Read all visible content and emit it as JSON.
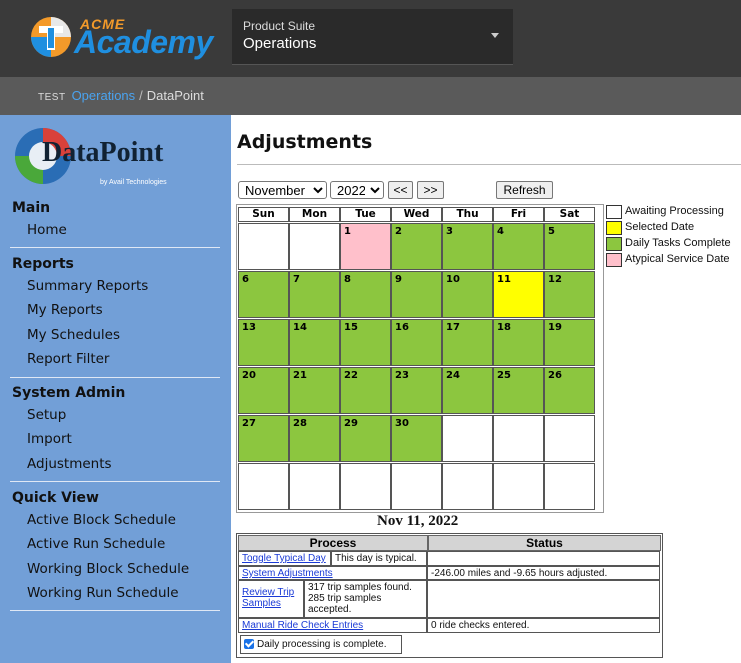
{
  "app": {
    "brand_top": "ACME",
    "brand_main": "Academy",
    "suite_label": "Product Suite",
    "suite_value": "Operations"
  },
  "breadcrumb": {
    "env": "TEST",
    "parent": "Operations",
    "separator": "/",
    "current": "DataPoint"
  },
  "sidebar": {
    "logo_text": "DataPoint",
    "logo_sub": "by Avail Technologies",
    "sections": [
      {
        "title": "Main",
        "items": [
          "Home"
        ]
      },
      {
        "title": "Reports",
        "items": [
          "Summary Reports",
          "My Reports",
          "My Schedules",
          "Report Filter"
        ]
      },
      {
        "title": "System Admin",
        "items": [
          "Setup",
          "Import",
          "Adjustments"
        ]
      },
      {
        "title": "Quick View",
        "items": [
          "Active Block Schedule",
          "Active Run Schedule",
          "Working Block Schedule",
          "Working Run Schedule"
        ]
      }
    ]
  },
  "page": {
    "title": "Adjustments"
  },
  "controls": {
    "month": "November",
    "year": "2022",
    "prev": "<<",
    "next": ">>",
    "refresh": "Refresh"
  },
  "calendar": {
    "days_of_week": [
      "Sun",
      "Mon",
      "Tue",
      "Wed",
      "Thu",
      "Fri",
      "Sat"
    ],
    "weeks": [
      [
        null,
        null,
        {
          "d": "1",
          "s": "atypical"
        },
        {
          "d": "2",
          "s": "complete"
        },
        {
          "d": "3",
          "s": "complete"
        },
        {
          "d": "4",
          "s": "complete"
        },
        {
          "d": "5",
          "s": "complete"
        }
      ],
      [
        {
          "d": "6",
          "s": "complete"
        },
        {
          "d": "7",
          "s": "complete"
        },
        {
          "d": "8",
          "s": "complete"
        },
        {
          "d": "9",
          "s": "complete"
        },
        {
          "d": "10",
          "s": "complete"
        },
        {
          "d": "11",
          "s": "selected"
        },
        {
          "d": "12",
          "s": "complete"
        }
      ],
      [
        {
          "d": "13",
          "s": "complete"
        },
        {
          "d": "14",
          "s": "complete"
        },
        {
          "d": "15",
          "s": "complete"
        },
        {
          "d": "16",
          "s": "complete"
        },
        {
          "d": "17",
          "s": "complete"
        },
        {
          "d": "18",
          "s": "complete"
        },
        {
          "d": "19",
          "s": "complete"
        }
      ],
      [
        {
          "d": "20",
          "s": "complete"
        },
        {
          "d": "21",
          "s": "complete"
        },
        {
          "d": "22",
          "s": "complete"
        },
        {
          "d": "23",
          "s": "complete"
        },
        {
          "d": "24",
          "s": "complete"
        },
        {
          "d": "25",
          "s": "complete"
        },
        {
          "d": "26",
          "s": "complete"
        }
      ],
      [
        {
          "d": "27",
          "s": "complete"
        },
        {
          "d": "28",
          "s": "complete"
        },
        {
          "d": "29",
          "s": "complete"
        },
        {
          "d": "30",
          "s": "complete"
        },
        null,
        null,
        null
      ],
      [
        null,
        null,
        null,
        null,
        null,
        null,
        null
      ]
    ]
  },
  "legend": [
    {
      "label": "Awaiting Processing",
      "color": "#ffffff"
    },
    {
      "label": "Selected Date",
      "color": "#ffff00"
    },
    {
      "label": "Daily Tasks Complete",
      "color": "#8cc63f"
    },
    {
      "label": "Atypical Service Date",
      "color": "#ffc0cb"
    }
  ],
  "status_colors": {
    "complete": "#8cc63f",
    "selected": "#ffff00",
    "atypical": "#ffc0cb",
    "awaiting": "#ffffff"
  },
  "selected_date": "Nov 11, 2022",
  "process_table": {
    "headers": [
      "Process",
      "Status"
    ],
    "rows": {
      "toggle_link": "Toggle Typical Day",
      "toggle_note": "This day is typical.",
      "sys_adj_link": "System Adjustments",
      "sys_adj_status": "-246.00 miles and -9.65 hours adjusted.",
      "review_link": "Review Trip Samples",
      "review_note": "317 trip samples found. 285 trip samples accepted.",
      "manual_link": "Manual Ride Check Entries",
      "manual_status": "0 ride checks entered.",
      "daily_complete": "Daily processing is complete."
    }
  }
}
